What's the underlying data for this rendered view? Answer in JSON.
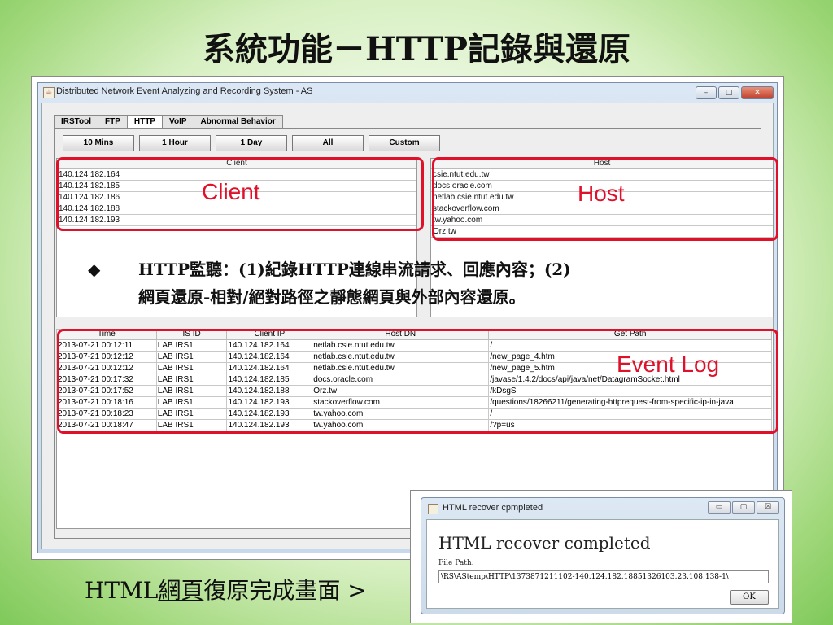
{
  "slide": {
    "title": "系統功能－HTTP記錄與還原",
    "note_bullet": "◆",
    "note_line1": "HTTP監聽：(1)紀錄HTTP連線串流請求、回應內容；(2)",
    "note_line2": "網頁還原-相對/絕對路徑之靜態網頁與外部內容還原。",
    "caption_prefix": "HTML",
    "caption_underlined": "網頁",
    "caption_suffix": "復原完成畫面 >"
  },
  "window": {
    "title": "Distributed Network Event Analyzing and Recording System - AS",
    "minimize": "–",
    "maximize": "□",
    "close": "✕"
  },
  "tabs": [
    "IRSTool",
    "FTP",
    "HTTP",
    "VoIP",
    "Abnormal Behavior"
  ],
  "active_tab": "HTTP",
  "time_buttons": [
    "10 Mins",
    "1 Hour",
    "1 Day",
    "All",
    "Custom"
  ],
  "client_panel": {
    "header": "Client",
    "rows": [
      "140.124.182.164",
      "140.124.182.185",
      "140.124.182.186",
      "140.124.182.188",
      "140.124.182.193"
    ],
    "annotation": "Client"
  },
  "host_panel": {
    "header": "Host",
    "rows": [
      "csie.ntut.edu.tw",
      "docs.oracle.com",
      "netlab.csie.ntut.edu.tw",
      "stackoverflow.com",
      "tw.yahoo.com",
      "Orz.tw"
    ],
    "annotation": "Host"
  },
  "event_log": {
    "annotation": "Event Log",
    "columns": [
      "Time",
      "IS ID",
      "Client IP",
      "Host DN",
      "Get Path"
    ],
    "rows": [
      [
        "2013-07-21 00:12:11",
        "LAB IRS1",
        "140.124.182.164",
        "netlab.csie.ntut.edu.tw",
        "/"
      ],
      [
        "2013-07-21 00:12:12",
        "LAB IRS1",
        "140.124.182.164",
        "netlab.csie.ntut.edu.tw",
        "/new_page_4.htm"
      ],
      [
        "2013-07-21 00:12:12",
        "LAB IRS1",
        "140.124.182.164",
        "netlab.csie.ntut.edu.tw",
        "/new_page_5.htm"
      ],
      [
        "2013-07-21 00:17:32",
        "LAB IRS1",
        "140.124.182.185",
        "docs.oracle.com",
        "/javase/1.4.2/docs/api/java/net/DatagramSocket.html"
      ],
      [
        "2013-07-21 00:17:52",
        "LAB IRS1",
        "140.124.182.188",
        "Orz.tw",
        "/kDsgS"
      ],
      [
        "2013-07-21 00:18:16",
        "LAB IRS1",
        "140.124.182.193",
        "stackoverflow.com",
        "/questions/18266211/generating-httprequest-from-specific-ip-in-java"
      ],
      [
        "2013-07-21 00:18:23",
        "LAB IRS1",
        "140.124.182.193",
        "tw.yahoo.com",
        "/"
      ],
      [
        "2013-07-21 00:18:47",
        "LAB IRS1",
        "140.124.182.193",
        "tw.yahoo.com",
        "/?p=us"
      ]
    ]
  },
  "dialog": {
    "title": "HTML recover cpmpleted",
    "message": "HTML recover completed",
    "file_path_label": "File Path:",
    "file_path_value": "\\RS\\AStemp\\HTTP\\1373871211102-140.124.182.18851326103.23.108.138-1\\",
    "ok_label": "OK",
    "minimize": "▭",
    "maximize": "▢",
    "close": "☒"
  }
}
